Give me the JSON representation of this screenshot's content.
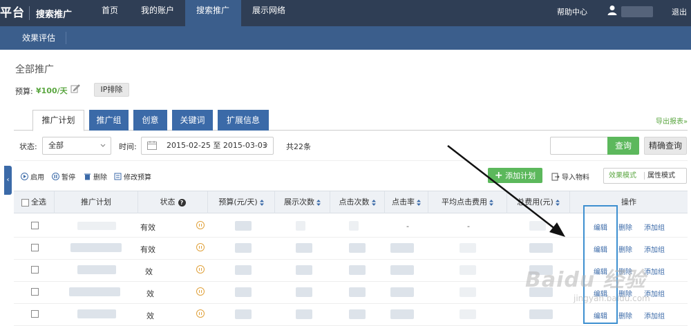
{
  "topnav": {
    "logo": "平台",
    "brand": "搜索推广",
    "items": [
      {
        "label": "首页"
      },
      {
        "label": "我的账户"
      },
      {
        "label": "搜索推广"
      },
      {
        "label": "展示网络"
      }
    ],
    "help": "帮助中心",
    "logout": "退出"
  },
  "subnav": {
    "item": "效果评估"
  },
  "page": {
    "title": "全部推广",
    "budget_label": "预算:",
    "budget_value": "¥100/天",
    "ip_button": "IP排除"
  },
  "tabs": [
    {
      "label": "推广计划"
    },
    {
      "label": "推广组"
    },
    {
      "label": "创意"
    },
    {
      "label": "关键词"
    },
    {
      "label": "扩展信息"
    }
  ],
  "export_link": "导出报表»",
  "filter": {
    "status_label": "状态:",
    "status_value": "全部",
    "time_label": "时间:",
    "date_range": "2015-02-25 至 2015-03-03",
    "total": "共22条",
    "query_button": "查询",
    "precise_button": "精确查询"
  },
  "actions": {
    "enable": "启用",
    "pause": "暂停",
    "delete": "删除",
    "modify_budget": "修改预算",
    "add_plan": "添加计划",
    "import": "导入物料",
    "mode_effect": "效果模式",
    "mode_attr": "属性模式"
  },
  "table": {
    "headers": {
      "select_all": "全选",
      "plan": "推广计划",
      "status": "状态",
      "budget": "预算(元/天)",
      "impressions": "展示次数",
      "clicks": "点击次数",
      "ctr": "点击率",
      "avg_cpc": "平均点击费用",
      "total_cost": "总费用(元)",
      "ops": "操作"
    },
    "rows": [
      {
        "status": "有效",
        "ctr": "-",
        "avg_cpc": "-"
      },
      {
        "status": "有效"
      },
      {
        "status": "效"
      },
      {
        "status": "效"
      },
      {
        "status": "效"
      }
    ],
    "op_labels": {
      "edit": "编辑",
      "delete": "删除",
      "add_group": "添加组"
    }
  },
  "watermark": {
    "main": "Baidu 经验",
    "sub": "jingyan.baidu.com"
  },
  "colors": {
    "nav": "#2f3e55",
    "accent_blue": "#3b6aa8",
    "green": "#5cb85c",
    "highlight": "#3d8fd0"
  }
}
